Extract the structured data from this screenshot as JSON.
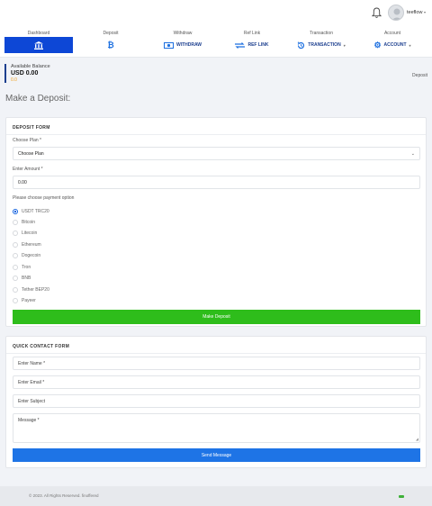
{
  "header": {
    "username": "teeflow"
  },
  "nav": [
    {
      "caption": "Dashboard",
      "label": "",
      "icon": "bank-icon",
      "active": true
    },
    {
      "caption": "Deposit",
      "label": "",
      "icon": "bitcoin-icon",
      "active": false
    },
    {
      "caption": "Withdraw",
      "label": "WITHDRAW",
      "icon": "money-icon",
      "active": false
    },
    {
      "caption": "Ref Link",
      "label": "REF LINK",
      "icon": "transfer-icon",
      "active": false
    },
    {
      "caption": "Transaction",
      "label": "TRANSACTION",
      "icon": "history-icon",
      "active": false
    },
    {
      "caption": "Account",
      "label": "ACCOUNT",
      "icon": "gear-icon",
      "active": false
    }
  ],
  "balance": {
    "label": "Available Balance",
    "value": "USD 0.00",
    "sub": "0.0"
  },
  "breadcrumb": "Deposit",
  "page_title": "Make a Deposit:",
  "deposit_form": {
    "title": "DEPOSIT FORM",
    "plan_label": "Choose Plan *",
    "plan_value": "Choose Plan",
    "amount_label": "Enter Amount *",
    "amount_value": "0.00",
    "payment_label": "Please choose payment option",
    "options": [
      "USDT TRC20",
      "Bitcoin",
      "Litecoin",
      "Ethereum",
      "Dogecoin",
      "Tron",
      "BNB",
      "Tether BEP20",
      "Payeer"
    ],
    "selected_option": "USDT TRC20",
    "submit_label": "Make Deposit"
  },
  "contact_form": {
    "title": "QUICK CONTACT FORM",
    "name_placeholder": "Enter Name *",
    "email_placeholder": "Enter Email *",
    "subject_placeholder": "Enter Subject",
    "message_placeholder": "Message *",
    "submit_label": "Send Message"
  },
  "footer": {
    "copyright": "© 2023. All Rights Reserved. finoffered"
  },
  "colors": {
    "primary": "#0d47d6",
    "nav_text": "#1c3f8f",
    "success": "#2ebd1b",
    "button_blue": "#1e74e6"
  }
}
